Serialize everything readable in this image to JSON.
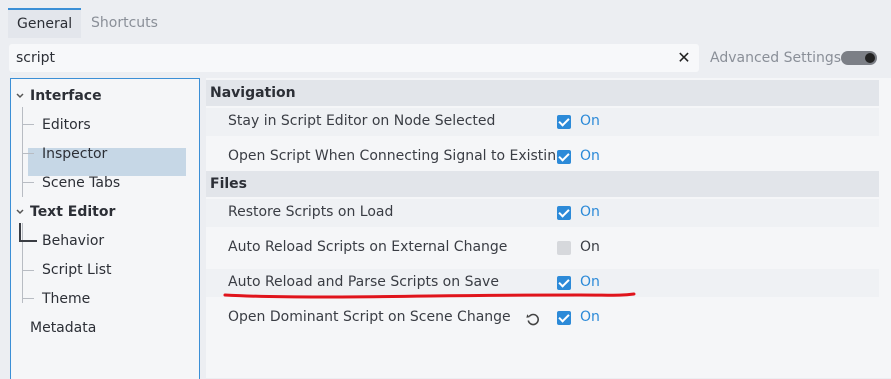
{
  "tabs": [
    {
      "label": "General"
    },
    {
      "label": "Shortcuts"
    }
  ],
  "search": {
    "value": "script"
  },
  "advanced": {
    "label": "Advanced Settings",
    "enabled": true
  },
  "tree": {
    "items": [
      {
        "label": "Interface"
      },
      {
        "label": "Editors"
      },
      {
        "label": "Inspector"
      },
      {
        "label": "Scene Tabs"
      },
      {
        "label": "Text Editor"
      },
      {
        "label": "Behavior"
      },
      {
        "label": "Script List"
      },
      {
        "label": "Theme"
      },
      {
        "label": "Metadata"
      }
    ],
    "selected": "Behavior"
  },
  "sections": [
    {
      "title": "Navigation"
    },
    {
      "title": "Files"
    }
  ],
  "settings": [
    {
      "label": "Stay in Script Editor on Node Selected",
      "value": "On",
      "checked": true
    },
    {
      "label": "Open Script When Connecting Signal to Existing",
      "value": "On",
      "checked": true
    },
    {
      "label": "Restore Scripts on Load",
      "value": "On",
      "checked": true
    },
    {
      "label": "Auto Reload Scripts on External Change",
      "value": "On",
      "checked": false
    },
    {
      "label": "Auto Reload and Parse Scripts on Save",
      "value": "On",
      "checked": true
    },
    {
      "label": "Open Dominant Script on Scene Change",
      "value": "On",
      "checked": true,
      "revert_icon": "revert-icon"
    }
  ],
  "colors": {
    "accent": "#2c8ad8",
    "annotation": "#e0141c"
  }
}
